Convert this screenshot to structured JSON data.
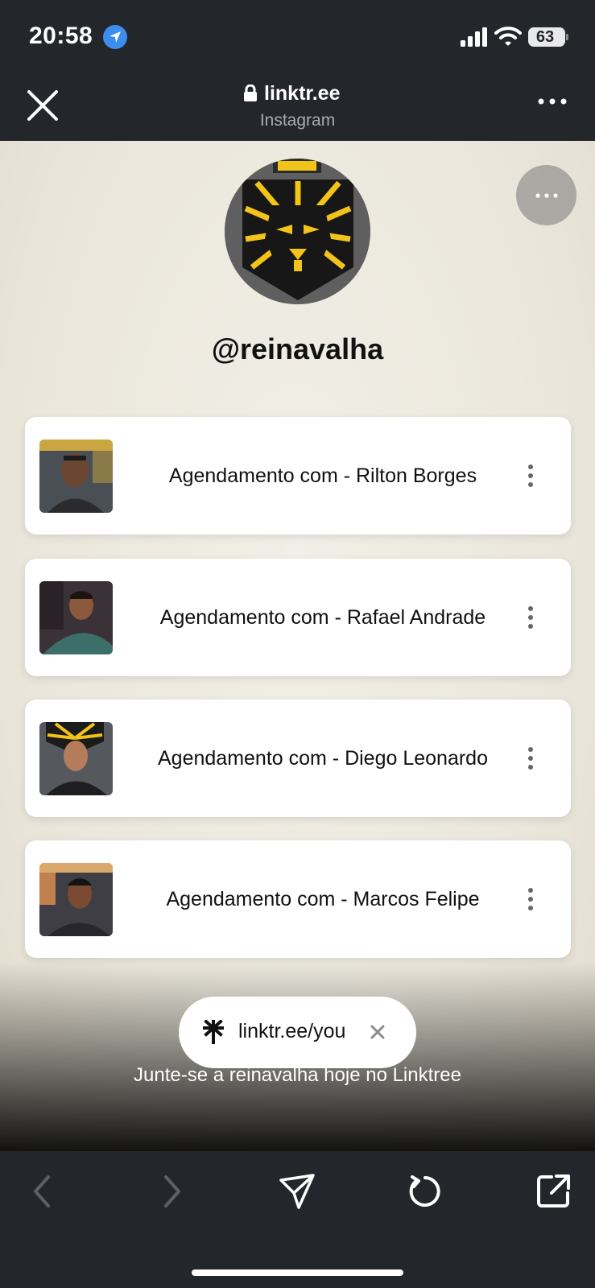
{
  "status_bar": {
    "time": "20:58",
    "battery": "63"
  },
  "browser": {
    "url": "linktr.ee",
    "source": "Instagram"
  },
  "profile": {
    "username": "@reinavalha"
  },
  "links": [
    {
      "label": "Agendamento com - Rilton Borges"
    },
    {
      "label": "Agendamento com - Rafael Andrade"
    },
    {
      "label": "Agendamento com - Diego Leonardo"
    },
    {
      "label": "Agendamento com - Marcos Felipe"
    }
  ],
  "join": {
    "pill_text": "linktr.ee/you",
    "text": "Junte-se a reinavalha hoje no Linktree"
  },
  "icons": {
    "status": [
      "location-arrow-icon",
      "signal-icon",
      "wifi-icon",
      "battery-icon"
    ],
    "header": [
      "close-icon",
      "lock-icon",
      "more-icon"
    ],
    "toolbar": [
      "back-icon",
      "forward-icon",
      "share-icon",
      "reload-icon",
      "open-external-icon"
    ]
  },
  "colors": {
    "chrome": "#23262b",
    "location": "#3b8df0",
    "brand_yellow": "#f2c318"
  }
}
